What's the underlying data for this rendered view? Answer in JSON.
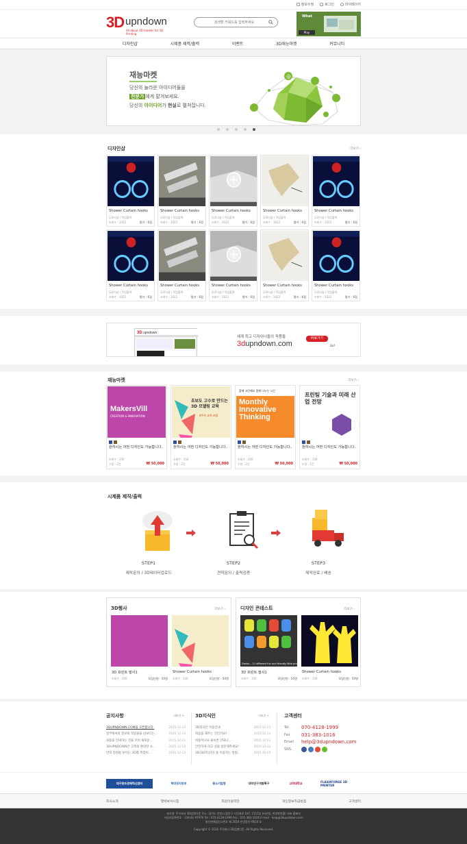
{
  "util": {
    "links": [
      "정보수정",
      "로그인",
      "마이페이지"
    ]
  },
  "header": {
    "logo_mark": "3D",
    "logo_word": "upndown",
    "logo_sub": "All about 3D models for 3D Printing",
    "search_placeholder": "검색할 키워드를 입력하세요",
    "banner_text": "What",
    "banner_button": "Play"
  },
  "nav": [
    "디자인샵",
    "시제품 제작/출력",
    "이벤트",
    "3D재능마켓",
    "커뮤니티"
  ],
  "hero": {
    "title": "재능마켓",
    "line1": "당신의 놀라운 아이디어들을",
    "line2_hl": "전문가",
    "line2_rest": "에게 맡겨보세요.",
    "line3_a": "당신의 ",
    "line3_hl": "아이디어",
    "line3_b": "가 ",
    "line3_hl2": "현실",
    "line3_c": "로 펼쳐집니다.",
    "dots": 5,
    "active_dot": 4
  },
  "design_shop": {
    "title": "디자인샵",
    "more": "더보기 ›",
    "items": [
      {
        "title": "Shower Curtain hooks",
        "cat": "무료디샵 / 작업출력",
        "views": "조회수 : 1022",
        "rating": "평가 : 6점",
        "img": "neon"
      },
      {
        "title": "Shower Curtain hooks",
        "cat": "무료디샵 / 작업출력",
        "views": "조회수 : 1022",
        "rating": "평가 : 6점",
        "img": "clips"
      },
      {
        "title": "Shower Curtain hooks",
        "cat": "무료디샵 / 작업출력",
        "views": "조회수 : 1022",
        "rating": "평가 : 6점",
        "img": "corner"
      },
      {
        "title": "Shower Curtain hooks",
        "cat": "무료디샵 / 작업출력",
        "views": "조회수 : 1022",
        "rating": "평가 : 6점",
        "img": "part"
      },
      {
        "title": "Shower Curtain hooks",
        "cat": "무료디샵 / 작업출력",
        "views": "조회수 : 1022",
        "rating": "평가 : 6점",
        "img": "neon"
      },
      {
        "title": "Shower Curtain hooks",
        "cat": "무료디샵 / 작업출력",
        "views": "조회수 : 1022",
        "rating": "평가 : 6점",
        "img": "neon"
      },
      {
        "title": "Shower Curtain hooks",
        "cat": "무료디샵 / 작업출력",
        "views": "조회수 : 1022",
        "rating": "평가 : 6점",
        "img": "clips"
      },
      {
        "title": "Shower Curtain hooks",
        "cat": "무료디샵 / 작업출력",
        "views": "조회수 : 1022",
        "rating": "평가 : 6점",
        "img": "corner"
      },
      {
        "title": "Shower Curtain hooks",
        "cat": "무료디샵 / 작업출력",
        "views": "조회수 : 1022",
        "rating": "평가 : 6점",
        "img": "part"
      },
      {
        "title": "Shower Curtain hooks",
        "cat": "무료디샵 / 작업출력",
        "views": "조회수 : 1022",
        "rating": "평가 : 6점",
        "img": "neon"
      }
    ]
  },
  "banner2": {
    "msg": "세계 최고 디자이너들의 작품들",
    "url_red": "3d",
    "url_rest": "upndown.com",
    "go": "바로가기",
    "go_small": "Go!"
  },
  "talent": {
    "title": "재능마켓",
    "more": "더보기 ›",
    "items": [
      {
        "title": "원하시는 어떤 디자인도 가능합니다..",
        "views": "조회수 : 150",
        "sales": "수량 : 2건",
        "price": "₩ 50,000",
        "img": "makers",
        "img_text": "MakersVill",
        "img_sub": "CREATION & INNOVATION"
      },
      {
        "title": "원하시는 어떤 디자인도 가능합니다..",
        "views": "조회수 : 150",
        "sales": "수량 : 2건",
        "price": "₩ 50,000",
        "img": "course",
        "img_text": "초보도 고수로 만드는 3D 모델링 교육",
        "img_sub": "4주차 교육 과정"
      },
      {
        "title": "원하시는 어떤 디자인도 가능합니다..",
        "views": "조회수 : 150",
        "sales": "수량 : 2건",
        "price": "₩ 50,000",
        "img": "monthly",
        "img_text": "Monthly Innovative Thinking",
        "img_sub": "함께 고민해요 함께 나누는 시간"
      },
      {
        "title": "원하시는 어떤 디자인도 가능합니다..",
        "views": "조회수 : 150",
        "sales": "수량 : 2건",
        "price": "₩ 50,000",
        "img": "print",
        "img_text": "프린팅 기술과 미래 산업 전망",
        "img_sub": "3D"
      }
    ]
  },
  "proto": {
    "title": "시제품 제작/출력",
    "steps": [
      {
        "label": "STEP1",
        "desc": "제작문의 / 3D데이터업로드"
      },
      {
        "label": "STEP2",
        "desc": "견적문의 / 출력검증"
      },
      {
        "label": "STEP3",
        "desc": "제작완료 / 배송"
      }
    ]
  },
  "events": {
    "title": "3D행사",
    "more": "더보기 ›",
    "items": [
      {
        "title": "3D 프린트 행사1",
        "views": "조회수 : 150",
        "meta": "모집인원 : 50명",
        "img": "makers"
      },
      {
        "title": "Shower Curtain hooks",
        "views": "조회수 : 150",
        "meta": "모집인원 : 50명",
        "img": "course"
      }
    ]
  },
  "contest": {
    "title": "디자인 콘테스트",
    "more": "더보기 ›",
    "items": [
      {
        "title": "3D 프린트 행사1",
        "views": "조회수 : 150",
        "meta": "모집인원 : 50명",
        "img": "robots",
        "img_caption": "Droids... 11 different fun and friendly little printa"
      },
      {
        "title": "Shower Curtain hooks",
        "views": "조회수 : 150",
        "meta": "모집인원 : 50명",
        "img": "cactus"
      }
    ]
  },
  "notice": {
    "title": "공지사항",
    "more": "더보기 +",
    "rows": [
      {
        "t": "3DUPNDOWN.COM을 오픈합니다.",
        "d": "2015-12-13"
      },
      {
        "t": "일부에서의 정보와 작업물을 남보다는...",
        "d": "2015-12-13"
      },
      {
        "t": "내용을 인내하는 것을 우린 새로운...",
        "d": "2015-12-13"
      },
      {
        "t": "3DUPNDOWN은 고객의 편의만 소...",
        "d": "2015-12-13"
      },
      {
        "t": "만약 정성을 보이는 3D를 저렴이...",
        "d": "2015-12-13"
      }
    ]
  },
  "knowledge": {
    "title": "3D지식인",
    "more": "더보기 +",
    "rows": [
      {
        "t": "3D지식인 이용안내",
        "d": "2015-12-13"
      },
      {
        "t": "처음을 해주는 것인가요?",
        "d": "2015-12-13"
      },
      {
        "t": "비용이나요 물보면 안되나...",
        "d": "2015-12-13"
      },
      {
        "t": "안전하게 하고 싶을 방문해주세요!",
        "d": "2015-12-13"
      },
      {
        "t": "3D(3D지식인) 을 이용하는 방법..",
        "d": "2015-12-13"
      }
    ]
  },
  "cs": {
    "title": "고객센터",
    "tel_label": "Tel.",
    "tel": "070-4128-1999",
    "fax_label": "Fax",
    "fax": "031-383-1016",
    "email_label": "Email",
    "email": "help@3dupndown.com",
    "sns_label": "SNS",
    "sns_colors": [
      "#3b5998",
      "#4a7ab8",
      "#e24a3b",
      "#6abb2e"
    ]
  },
  "partners": [
    "대구창조경제혁신센터",
    "북대경지방부",
    "중소기업청",
    "대덕연구개발특구",
    "고려대학교",
    "FLASHFORGE 3D PRINTER"
  ],
  "footer_menu": [
    "회사소개",
    "행박보서시침",
    "회원이용약관",
    "개인정보취급방침",
    "고객센터"
  ],
  "copyright": {
    "line1": "회사명: 주식회사 3D업앤다운 주소: 경기도 안양시 동안구 시민대로 187, 1111호 (비산동, 한양벤처텔) 대표 홍혜지",
    "line2": "사업자등록번호 : 138-81-97976 Tel : 070-4128-1999 Fax : 031-383-1016 E-mail : help@3dupndown.com",
    "line3": "통신판매업신고번호 제 2016-안양동안-0624 호",
    "line4": "Copyright © 2016 주식회사 3D업앤다운. All Rights Reserved."
  },
  "colors": {
    "brand_red": "#d71e23",
    "hero_green": "#6a9f24",
    "footer_bg": "#333333"
  }
}
